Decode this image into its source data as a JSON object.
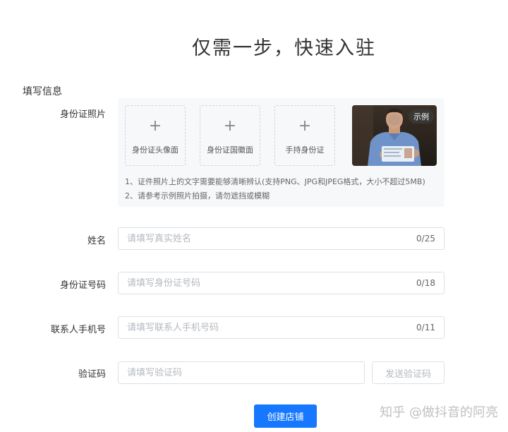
{
  "page": {
    "title": "仅需一步，快速入驻",
    "section_title": "填写信息"
  },
  "id_photos": {
    "label": "身份证照片",
    "slots": [
      {
        "label": "身份证头像面"
      },
      {
        "label": "身份证国徽面"
      },
      {
        "label": "手持身份证"
      }
    ],
    "plus_symbol": "+",
    "example_badge": "示例",
    "notes": [
      "1、证件照片上的文字需要能够清晰辨认(支持PNG、JPG和JPEG格式，大小不超过5MB)",
      "2、请参考示例照片拍摄，请勿遮挡或模糊"
    ]
  },
  "fields": {
    "name": {
      "label": "姓名",
      "placeholder": "请填写真实姓名",
      "value": "",
      "counter": "0/25"
    },
    "id_number": {
      "label": "身份证号码",
      "placeholder": "请填写身份证号码",
      "value": "",
      "counter": "0/18"
    },
    "phone": {
      "label": "联系人手机号",
      "placeholder": "请填写联系人手机号码",
      "value": "",
      "counter": "0/11"
    },
    "code": {
      "label": "验证码",
      "placeholder": "请填写验证码",
      "value": "",
      "send_label": "发送验证码"
    }
  },
  "submit_label": "创建店铺",
  "watermark": "知乎 @做抖音的阿亮",
  "colors": {
    "primary": "#1677ff",
    "border": "#dcdfe6",
    "panel_bg": "#f7f8fa"
  }
}
